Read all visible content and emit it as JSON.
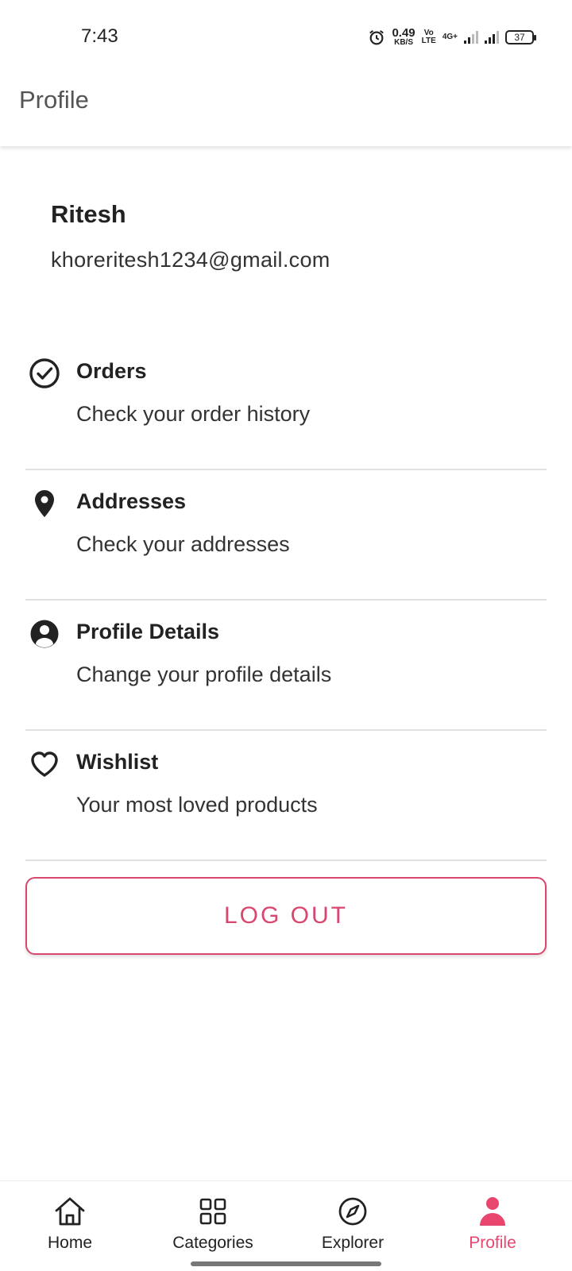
{
  "status_bar": {
    "time": "7:43",
    "net_speed_value": "0.49",
    "net_speed_unit": "KB/S",
    "volte_top": "Vo",
    "volte_bottom": "LTE",
    "network_type": "4G+",
    "battery": "37"
  },
  "app_bar": {
    "title": "Profile"
  },
  "user": {
    "name": "Ritesh",
    "email": "khoreritesh1234@gmail.com"
  },
  "menu": [
    {
      "title": "Orders",
      "subtitle": "Check your order history",
      "icon": "check-circle-icon"
    },
    {
      "title": "Addresses",
      "subtitle": "Check your addresses",
      "icon": "location-pin-icon"
    },
    {
      "title": "Profile Details",
      "subtitle": "Change your profile details",
      "icon": "account-circle-icon"
    },
    {
      "title": "Wishlist",
      "subtitle": "Your most loved products",
      "icon": "heart-icon"
    }
  ],
  "logout_label": "LOG OUT",
  "bottom_nav": [
    {
      "label": "Home",
      "icon": "home-icon",
      "active": false
    },
    {
      "label": "Categories",
      "icon": "grid-icon",
      "active": false
    },
    {
      "label": "Explorer",
      "icon": "compass-icon",
      "active": false
    },
    {
      "label": "Profile",
      "icon": "person-icon",
      "active": true
    }
  ],
  "colors": {
    "accent": "#e8466f",
    "text": "#222222",
    "divider": "#e0e0e0"
  }
}
